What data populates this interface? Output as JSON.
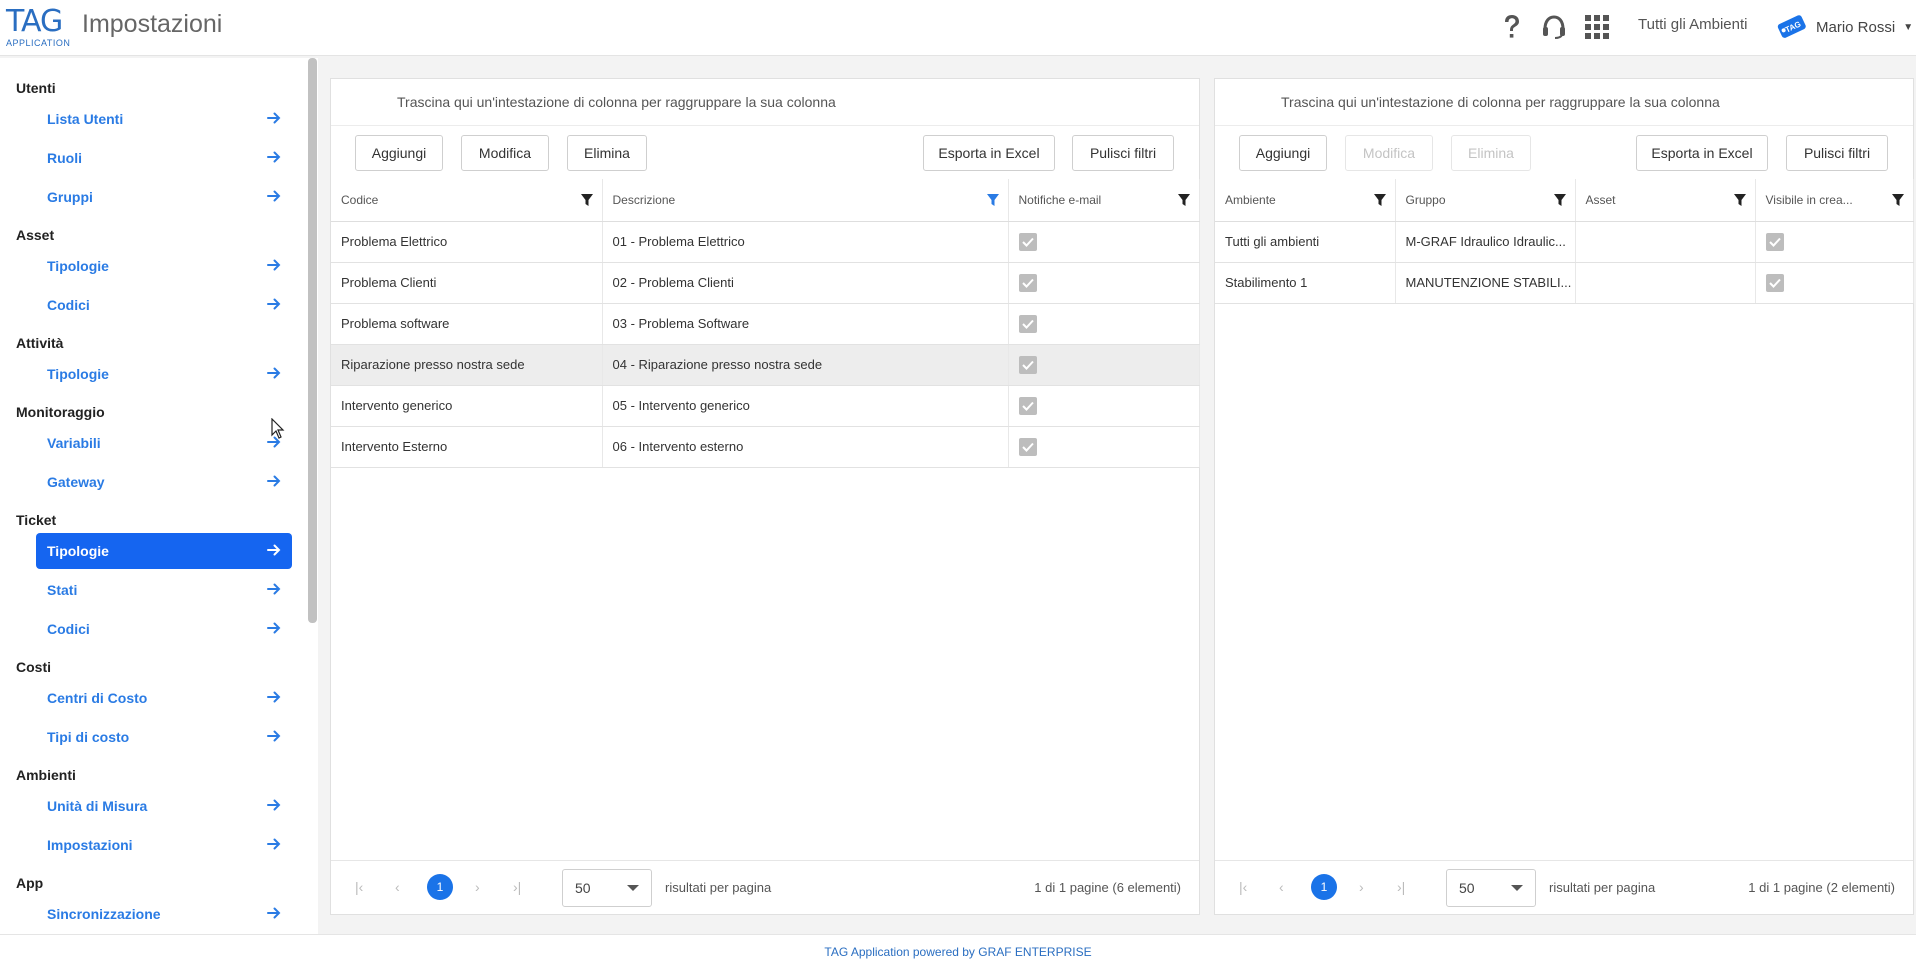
{
  "app": {
    "logo_main": "TAG",
    "logo_sub": "APPLICATION",
    "page_title": "Impostazioni",
    "environment": "Tutti gli Ambienti",
    "user_name": "Mario Rossi",
    "user_badge": "TAG"
  },
  "icons": {
    "help": "question-icon",
    "support": "headset-icon",
    "apps": "grid-icon",
    "nav_arrow": "arrow-right-icon",
    "filter": "filter-icon"
  },
  "colors": {
    "accent": "#2a7be4",
    "active": "#1565f0",
    "filter_active": "#2a7be4"
  },
  "sidebar": {
    "sections": [
      {
        "title": "Utenti",
        "items": [
          "Lista Utenti",
          "Ruoli",
          "Gruppi"
        ]
      },
      {
        "title": "Asset",
        "items": [
          "Tipologie",
          "Codici"
        ]
      },
      {
        "title": "Attività",
        "items": [
          "Tipologie"
        ]
      },
      {
        "title": "Monitoraggio",
        "items": [
          "Variabili",
          "Gateway"
        ]
      },
      {
        "title": "Ticket",
        "items": [
          "Tipologie",
          "Stati",
          "Codici"
        ]
      },
      {
        "title": "Costi",
        "items": [
          "Centri di Costo",
          "Tipi di costo"
        ]
      },
      {
        "title": "Ambienti",
        "items": [
          "Unità di Misura",
          "Impostazioni"
        ]
      },
      {
        "title": "App",
        "items": [
          "Sincronizzazione"
        ]
      }
    ],
    "active": "Ticket / Tipologie"
  },
  "left_panel": {
    "group_hint": "Trascina qui un'intestazione di colonna per raggruppare la sua colonna",
    "buttons": {
      "add": "Aggiungi",
      "edit": "Modifica",
      "delete": "Elimina",
      "export": "Esporta in Excel",
      "clear": "Pulisci filtri"
    },
    "columns": [
      "Codice",
      "Descrizione",
      "Notifiche e-mail"
    ],
    "rows": [
      [
        "Problema Elettrico",
        "01 - Problema Elettrico"
      ],
      [
        "Problema Clienti",
        "02 - Problema Clienti"
      ],
      [
        "Problema software",
        "03 - Problema Software"
      ],
      [
        "Riparazione presso nostra sede",
        "04 - Riparazione presso nostra sede"
      ],
      [
        "Intervento generico",
        "05 - Intervento generico"
      ],
      [
        "Intervento Esterno",
        "06 - Intervento esterno"
      ]
    ],
    "pager": {
      "page": "1",
      "size": "50",
      "per_page": "risultati per pagina",
      "summary": "1 di 1 pagine (6 elementi)"
    }
  },
  "right_panel": {
    "group_hint": "Trascina qui un'intestazione di colonna per raggruppare la sua colonna",
    "buttons": {
      "add": "Aggiungi",
      "edit": "Modifica",
      "delete": "Elimina",
      "export": "Esporta in Excel",
      "clear": "Pulisci filtri"
    },
    "columns": [
      "Ambiente",
      "Gruppo",
      "Asset",
      "Visibile in crea..."
    ],
    "rows": [
      [
        "Tutti gli ambienti",
        "M-GRAF Idraulico Idraulic...",
        ""
      ],
      [
        "Stabilimento 1",
        "MANUTENZIONE STABILI...",
        ""
      ]
    ],
    "pager": {
      "page": "1",
      "size": "50",
      "per_page": "risultati per pagina",
      "summary": "1 di 1 pagine (2 elementi)"
    }
  },
  "footer": "TAG Application powered by GRAF ENTERPRISE"
}
